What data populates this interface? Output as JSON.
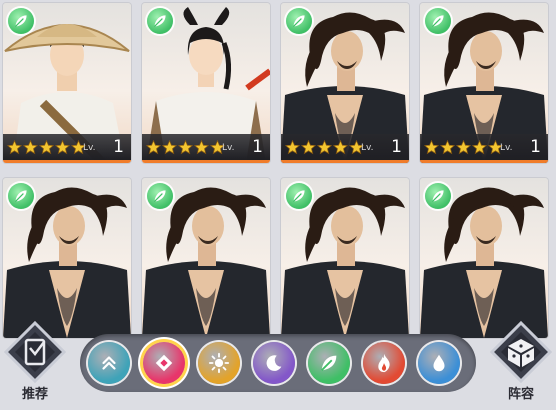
{
  "cards": [
    {
      "character": "hat-swordsman",
      "stars": 5,
      "lv_label": "Lv.",
      "level": "1",
      "element": "wind"
    },
    {
      "character": "ponytail-girl",
      "stars": 5,
      "lv_label": "Lv.",
      "level": "1",
      "element": "wind"
    },
    {
      "character": "long-hair-warrior",
      "stars": 5,
      "lv_label": "Lv.",
      "level": "1",
      "element": "wind"
    },
    {
      "character": "long-hair-warrior",
      "stars": 5,
      "lv_label": "Lv.",
      "level": "1",
      "element": "wind"
    },
    {
      "character": "long-hair-warrior",
      "element": "wind"
    },
    {
      "character": "long-hair-warrior",
      "element": "wind"
    },
    {
      "character": "long-hair-warrior",
      "element": "wind"
    },
    {
      "character": "long-hair-warrior",
      "element": "wind"
    }
  ],
  "left_button": {
    "label": "推荐",
    "icon": "recommend-icon"
  },
  "right_button": {
    "label": "阵容",
    "icon": "formation-icon"
  },
  "filters": [
    {
      "icon": "rank-up-icon",
      "color": "#3fa3b8"
    },
    {
      "icon": "all-elements-icon",
      "color": "#e8356a",
      "selected": true
    },
    {
      "icon": "sun-icon",
      "color": "#e3a32a"
    },
    {
      "icon": "moon-icon",
      "color": "#8357c9"
    },
    {
      "icon": "leaf-icon",
      "color": "#3fbf66"
    },
    {
      "icon": "fire-icon",
      "color": "#e24a33"
    },
    {
      "icon": "water-icon",
      "color": "#3c8fd6"
    }
  ],
  "colors": {
    "accent": "#f07c2a",
    "star": "#f2c530",
    "wind": "#3fbf66"
  }
}
